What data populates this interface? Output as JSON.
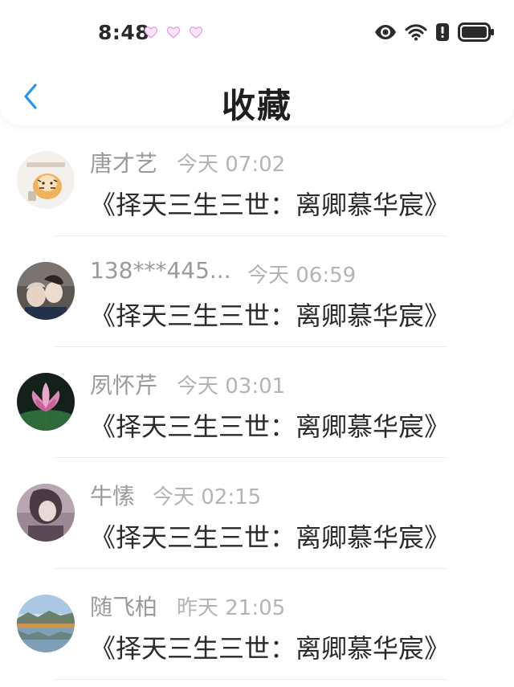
{
  "status_bar": {
    "time": "8:48",
    "icons": [
      "heart-icon",
      "heart-icon",
      "heart-icon",
      "eye-icon",
      "wifi-icon",
      "alert-icon",
      "battery-icon"
    ]
  },
  "nav": {
    "back_icon": "chevron-left-icon",
    "title": "收藏"
  },
  "colors": {
    "accent": "#2196f3",
    "name_text": "#9a9a9a",
    "time_text": "#b4b4b4",
    "title_text": "#2b2b2b"
  },
  "favorites": [
    {
      "user": "唐才艺",
      "time": "今天 07:02",
      "title": "《择天三生三世：离卿慕华宸》"
    },
    {
      "user": "138***445...",
      "time": "今天 06:59",
      "title": "《择天三生三世：离卿慕华宸》"
    },
    {
      "user": "夙怀芹",
      "time": "今天 03:01",
      "title": "《择天三生三世：离卿慕华宸》"
    },
    {
      "user": "牛愫",
      "time": "今天 02:15",
      "title": "《择天三生三世：离卿慕华宸》"
    },
    {
      "user": "随飞柏",
      "time": "昨天 21:05",
      "title": "《择天三生三世：离卿慕华宸》"
    }
  ]
}
